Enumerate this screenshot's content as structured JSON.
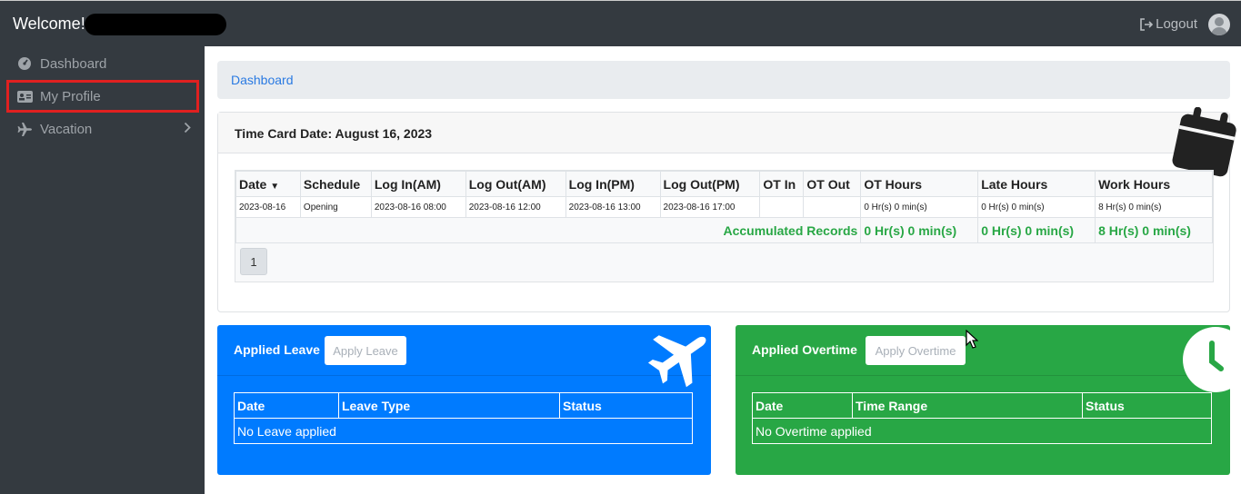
{
  "header": {
    "welcome": "Welcome!",
    "logout_label": "Logout",
    "icons": [
      "logout-icon",
      "user-avatar-icon"
    ]
  },
  "sidebar": {
    "items": [
      {
        "label": "Dashboard",
        "icon": "tachometer-icon"
      },
      {
        "label": "My Profile",
        "icon": "id-card-icon",
        "selected": true
      },
      {
        "label": "Vacation",
        "icon": "plane-icon",
        "has_submenu": true
      }
    ]
  },
  "breadcrumb": {
    "label": "Dashboard"
  },
  "timecard": {
    "title": "Time Card Date: August 16, 2023",
    "columns": [
      "Date",
      "Schedule",
      "Log In(AM)",
      "Log Out(AM)",
      "Log In(PM)",
      "Log Out(PM)",
      "OT In",
      "OT Out",
      "OT Hours",
      "Late Hours",
      "Work Hours"
    ],
    "rows": [
      [
        "2023-08-16",
        "Opening",
        "2023-08-16 08:00",
        "2023-08-16 12:00",
        "2023-08-16 13:00",
        "2023-08-16 17:00",
        "",
        "",
        "0 Hr(s) 0 min(s)",
        "0 Hr(s) 0 min(s)",
        "8 Hr(s) 0 min(s)"
      ]
    ],
    "accumulated_label": "Accumulated Records",
    "accumulated": {
      "ot_hours": "0 Hr(s) 0 min(s)",
      "late_hours": "0 Hr(s) 0 min(s)",
      "work_hours": "8 Hr(s) 0 min(s)"
    },
    "page": "1"
  },
  "leave": {
    "title": "Applied Leave",
    "button": "Apply Leave",
    "columns": [
      "Date",
      "Leave Type",
      "Status"
    ],
    "empty": "No Leave applied",
    "color": "#007bff"
  },
  "overtime": {
    "title": "Applied Overtime",
    "button": "Apply Overtime",
    "columns": [
      "Date",
      "Time Range",
      "Status"
    ],
    "empty": "No Overtime applied",
    "color": "#28a745"
  }
}
